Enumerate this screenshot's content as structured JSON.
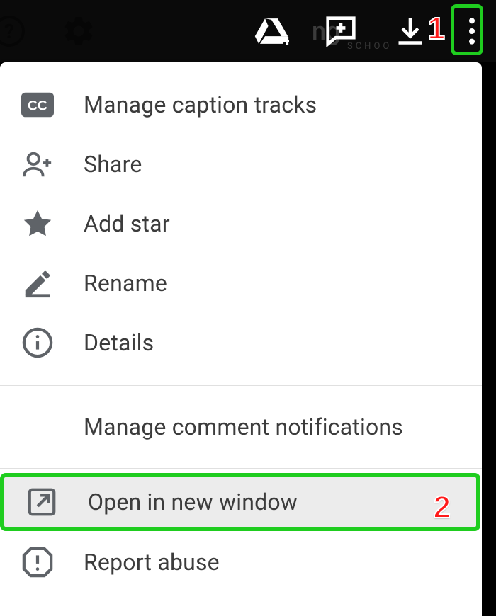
{
  "header": {
    "faded_text": "ng",
    "faded_subtext": "SCHOO"
  },
  "menu": {
    "section1": [
      {
        "label": "Manage caption tracks"
      },
      {
        "label": "Share"
      },
      {
        "label": "Add star"
      },
      {
        "label": "Rename"
      },
      {
        "label": "Details"
      }
    ],
    "section2": [
      {
        "label": "Manage comment notifications"
      }
    ],
    "section3": [
      {
        "label": "Open in new window"
      },
      {
        "label": "Report abuse"
      }
    ]
  },
  "callouts": {
    "one": "1",
    "two": "2"
  }
}
